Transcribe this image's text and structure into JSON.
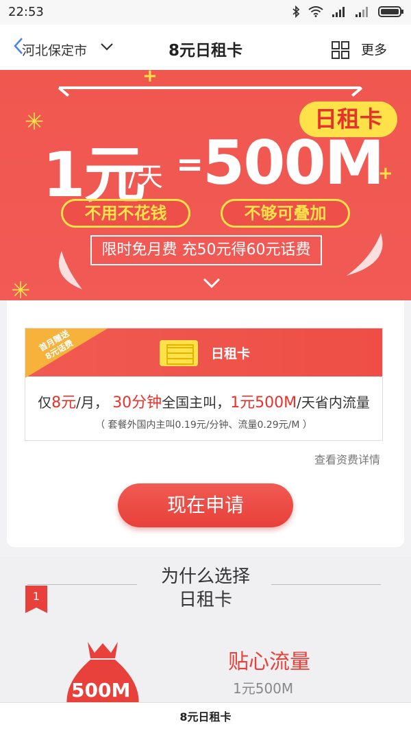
{
  "status_bar": {
    "time": "22:53"
  },
  "nav": {
    "city": "河北保定市",
    "title": "8元日租卡",
    "more_label": "更多"
  },
  "banner": {
    "badge": "日租卡",
    "price": "1元",
    "per_day": "/天",
    "equals": "=",
    "data_amount": "500M",
    "pill_1": "不用不花钱",
    "pill_2": "不够可叠加",
    "promo": "限时免月费 充50元得60元话费"
  },
  "plan_card": {
    "corner_line1": "首月赠送",
    "corner_line2": "8元话费",
    "name": "日租卡",
    "desc_prefix": "仅",
    "desc_price": "8元",
    "desc_month": "/月，",
    "desc_minutes": "30分钟",
    "desc_call": "全国主叫，",
    "desc_daily": "1元500M",
    "desc_flow": "/天省内流量",
    "sub": "（ 套餐外国内主叫0.19元/分钟、流量0.29元/M ）"
  },
  "detail_link": "查看资费详情",
  "apply_button": "现在申请",
  "why": {
    "title_line1": "为什么选择",
    "title_line2": "日租卡",
    "number": "1",
    "bag_label": "500M",
    "feature_title": "贴心流量",
    "feature_sub": "1元500M"
  },
  "bottom_bar": {
    "title": "8元日租卡"
  },
  "colors": {
    "brand_red": "#f0574f",
    "accent_yellow": "#ffe14a",
    "corner_orange": "#f6b23b"
  }
}
